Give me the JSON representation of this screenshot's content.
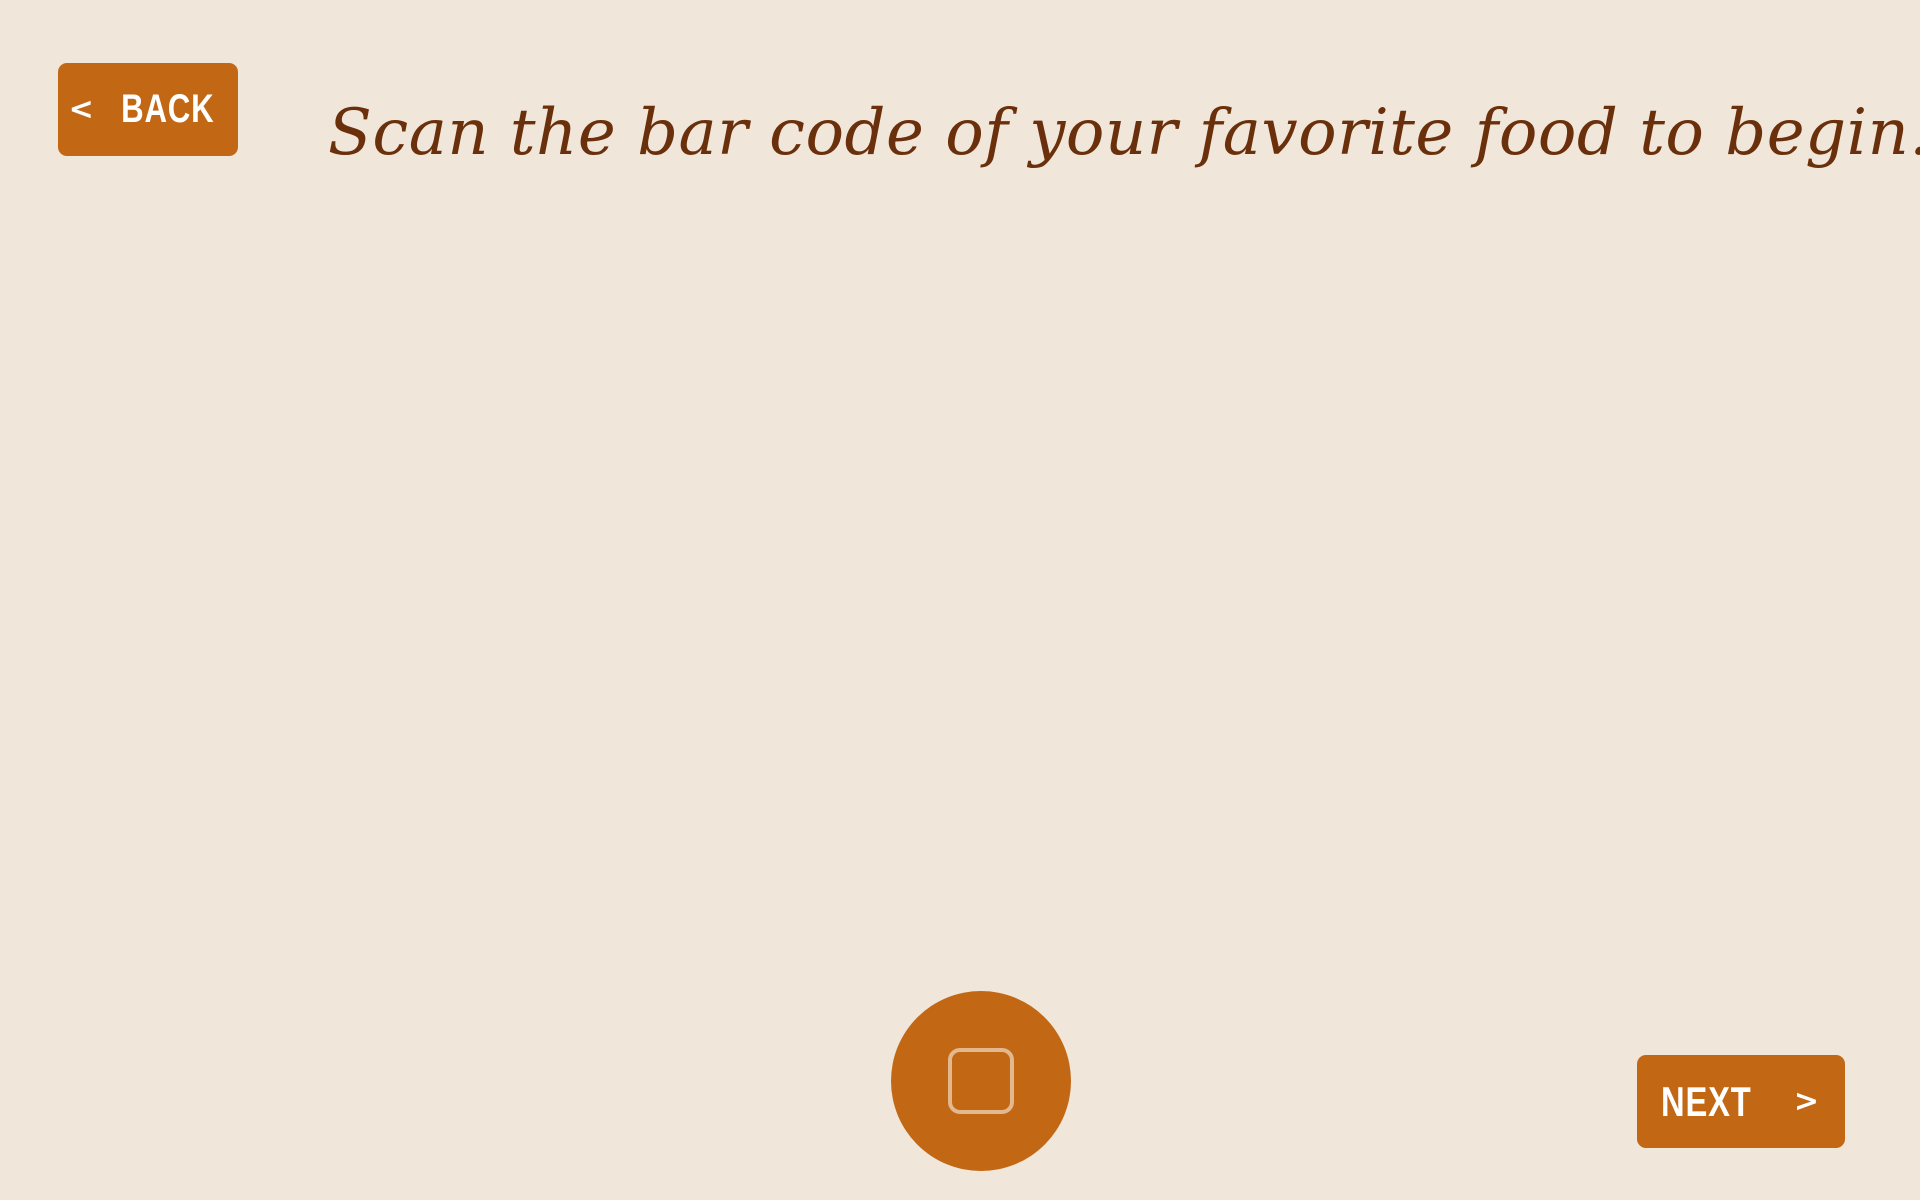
{
  "header": {
    "back_chevron": "<",
    "back_label": "BACK",
    "title": "Scan the bar code of your favorite food to begin."
  },
  "camera": {
    "capture_icon": "square-icon"
  },
  "footer": {
    "next_label": "NEXT",
    "next_chevron": ">"
  },
  "colors": {
    "background": "#f1e6da",
    "accent": "#c26714",
    "title_text": "#6a300c",
    "button_text": "#ffffff",
    "icon_outline": "#e2b98f"
  }
}
